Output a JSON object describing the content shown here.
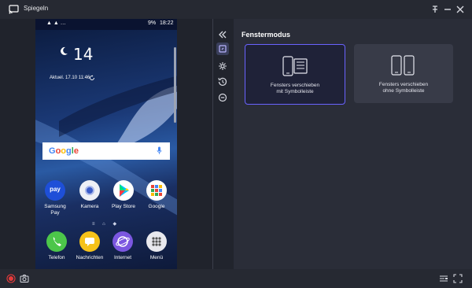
{
  "window": {
    "title": "Spiegeln"
  },
  "phone": {
    "status": {
      "carrier": "▲ ▲ …",
      "signal": "9%",
      "time": "18:22"
    },
    "weather": {
      "temperature": "14",
      "unit": "°",
      "updated": "Aktuel. 17.10 11:46"
    },
    "search": {
      "logo": "Google"
    },
    "apps": [
      {
        "label": "Samsung\nPay",
        "icon": "pay",
        "text": "pay",
        "color": "#1e4fd8"
      },
      {
        "label": "Kamera",
        "icon": "camera-app-icon",
        "color": "#f2f3f8"
      },
      {
        "label": "Play Store",
        "icon": "play-store-icon",
        "color": "#ffffff"
      },
      {
        "label": "Google",
        "icon": "google-folder-icon",
        "color": "#ffffff"
      }
    ],
    "dock": [
      {
        "label": "Telefon",
        "icon": "phone-icon",
        "color": "#4cc64a"
      },
      {
        "label": "Nachrichten",
        "icon": "messages-icon",
        "color": "#f6c21a"
      },
      {
        "label": "Internet",
        "icon": "internet-icon",
        "color": "#7b57e0"
      },
      {
        "label": "Menü",
        "icon": "menu-icon",
        "color": "#e9e9ee"
      }
    ]
  },
  "panel": {
    "title": "Fenstermodus",
    "cards": [
      {
        "caption": "Fensters verschieben\nmit Symbolleiste",
        "selected": true
      },
      {
        "caption": "Fensters verschieben\nohne Symbolleiste",
        "selected": false
      }
    ]
  },
  "colors": {
    "accent": "#6a63ff",
    "record": "#e83b3b"
  }
}
